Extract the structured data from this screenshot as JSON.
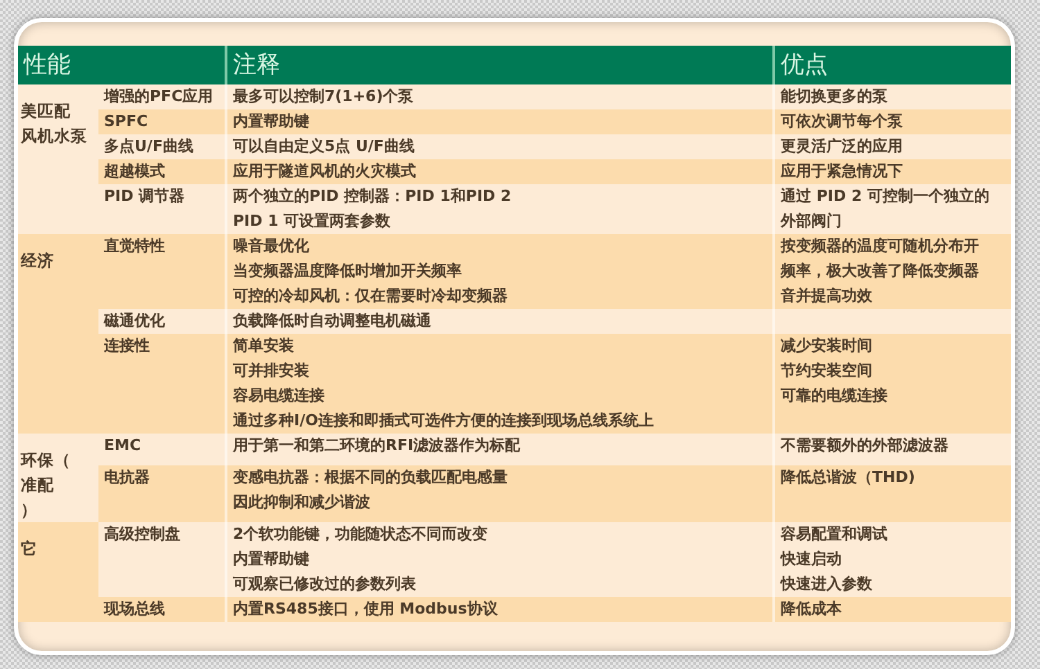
{
  "table": {
    "columns": [
      "性能",
      "注释",
      "优点"
    ],
    "groups": [
      {
        "label_lines": [
          "美匹配",
          "风机水泵"
        ],
        "shaded": false,
        "rows": [
          {
            "feature": "增强的PFC应用",
            "shaded": false,
            "notes": [
              "最多可以控制7(1+6)个泵"
            ],
            "advantages": [
              "能切换更多的泵"
            ]
          },
          {
            "feature": "SPFC",
            "shaded": true,
            "notes": [
              "内置帮助键"
            ],
            "advantages": [
              "可依次调节每个泵"
            ]
          },
          {
            "feature": "多点U/F曲线",
            "shaded": false,
            "notes": [
              "可以自由定义5点  U/F曲线"
            ],
            "advantages": [
              "更灵活广泛的应用"
            ]
          },
          {
            "feature": "超越模式",
            "shaded": true,
            "notes": [
              "应用于隧道风机的火灾模式"
            ],
            "advantages": [
              "应用于紧急情况下"
            ]
          },
          {
            "feature": "PID 调节器",
            "shaded": false,
            "notes": [
              "两个独立的PID 控制器：PID 1和PID 2",
              "PID 1 可设置两套参数"
            ],
            "advantages": [
              "通过  PID 2 可控制一个独立的",
              "外部阀门"
            ]
          }
        ]
      },
      {
        "label_lines": [
          "经济"
        ],
        "shaded": true,
        "rows": [
          {
            "feature": "直觉特性",
            "shaded": true,
            "notes": [
              "噪音最优化",
              "当变频器温度降低时增加开关频率",
              "可控的冷却风机：仅在需要时冷却变频器"
            ],
            "advantages": [
              "按变频器的温度可随机分布开",
              "频率，极大改善了降低变频器",
              "音并提高功效"
            ]
          },
          {
            "feature": "磁通优化",
            "shaded": false,
            "notes": [
              "负载降低时自动调整电机磁通"
            ],
            "advantages": []
          },
          {
            "feature": "连接性",
            "shaded": true,
            "notes": [
              "简单安装",
              "可并排安装",
              "容易电缆连接",
              "通过多种I/O连接和即插式可选件方便的连接到现场总线系统上"
            ],
            "advantages": [
              "减少安装时间",
              "节约安装空间",
              "可靠的电缆连接"
            ]
          }
        ]
      },
      {
        "label_lines": [
          "环保（",
          "准配",
          "）"
        ],
        "shaded": false,
        "rows": [
          {
            "feature": "EMC",
            "shaded": false,
            "notes": [
              "用于第一和第二环境的RFI滤波器作为标配"
            ],
            "advantages": [
              "不需要额外的外部滤波器"
            ]
          },
          {
            "feature": "电抗器",
            "shaded": true,
            "notes": [
              "变感电抗器：根据不同的负载匹配电感量",
              "因此抑制和减少谐波"
            ],
            "advantages": [
              "降低总谐波（THD)"
            ]
          }
        ]
      },
      {
        "label_lines": [
          "它"
        ],
        "shaded": true,
        "rows": [
          {
            "feature": "高级控制盘",
            "shaded": false,
            "notes": [
              "2个软功能键，功能随状态不同而改变",
              "内置帮助键",
              "可观察已修改过的参数列表"
            ],
            "advantages": [
              "容易配置和调试",
              "快速启动",
              "快速进入参数"
            ]
          },
          {
            "feature": "现场总线",
            "shaded": true,
            "notes": [
              "内置RS485接口，使用 Modbus协议"
            ],
            "advantages": [
              "降低成本"
            ]
          }
        ]
      }
    ]
  }
}
